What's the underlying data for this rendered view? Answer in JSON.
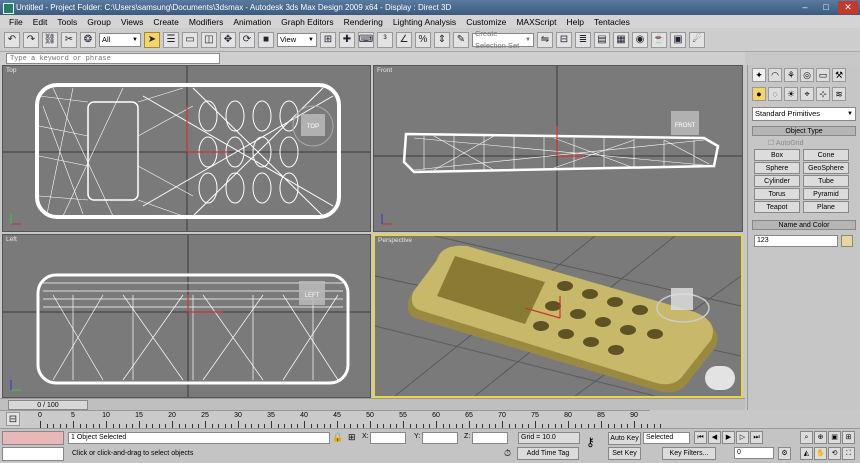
{
  "window": {
    "title": "Untitled     - Project Folder: C:\\Users\\samsung\\Documents\\3dsmax     - Autodesk 3ds Max Design 2009 x64     - Display : Direct 3D",
    "min_glyph": "–",
    "max_glyph": "□",
    "close_glyph": "✕"
  },
  "menu": [
    "File",
    "Edit",
    "Tools",
    "Group",
    "Views",
    "Create",
    "Modifiers",
    "Animation",
    "Graph Editors",
    "Rendering",
    "Lighting Analysis",
    "Customize",
    "MAXScript",
    "Help",
    "Tentacles"
  ],
  "toolbar": {
    "filter_value": "All",
    "refcoord_value": "View",
    "selection_set_placeholder": "Create Selection Set"
  },
  "search": {
    "placeholder": "Type a keyword or phrase"
  },
  "viewports": {
    "top": {
      "label": "Top",
      "cube_label": "TOP"
    },
    "front": {
      "label": "Front",
      "cube_label": "FRONT"
    },
    "left": {
      "label": "Left",
      "cube_label": "LEFT"
    },
    "perspective": {
      "label": "Perspective"
    }
  },
  "command_panel": {
    "category_value": "Standard Primitives",
    "object_type_title": "Object Type",
    "autogrid_label": "AutoGrid",
    "buttons": [
      "Box",
      "Cone",
      "Sphere",
      "GeoSphere",
      "Cylinder",
      "Tube",
      "Torus",
      "Pyramid",
      "Teapot",
      "Plane"
    ],
    "name_color_title": "Name and Color",
    "object_name": "123",
    "object_color": "#e8d79a"
  },
  "timeline": {
    "slider_label": "0 / 100",
    "ticks": [
      "0",
      "5",
      "10",
      "15",
      "20",
      "25",
      "30",
      "35",
      "40",
      "45",
      "50",
      "55",
      "60",
      "65",
      "70",
      "75",
      "80",
      "85",
      "90"
    ]
  },
  "status": {
    "selection_text": "1 Object Selected",
    "prompt_text": "Click or click-and-drag to select objects",
    "x_label": "X:",
    "y_label": "Y:",
    "z_label": "Z:",
    "grid_text": "Grid = 10.0",
    "add_time_tag": "Add Time Tag",
    "auto_key": "Auto Key",
    "selected_value": "Selected",
    "set_key": "Set Key",
    "key_filters": "Key Filters...",
    "frame_value": "0"
  },
  "colors": {
    "active_viewport_border": "#e8d34a",
    "phone_body": "#c8b86a",
    "viewport_bg": "#7a7a7a"
  }
}
